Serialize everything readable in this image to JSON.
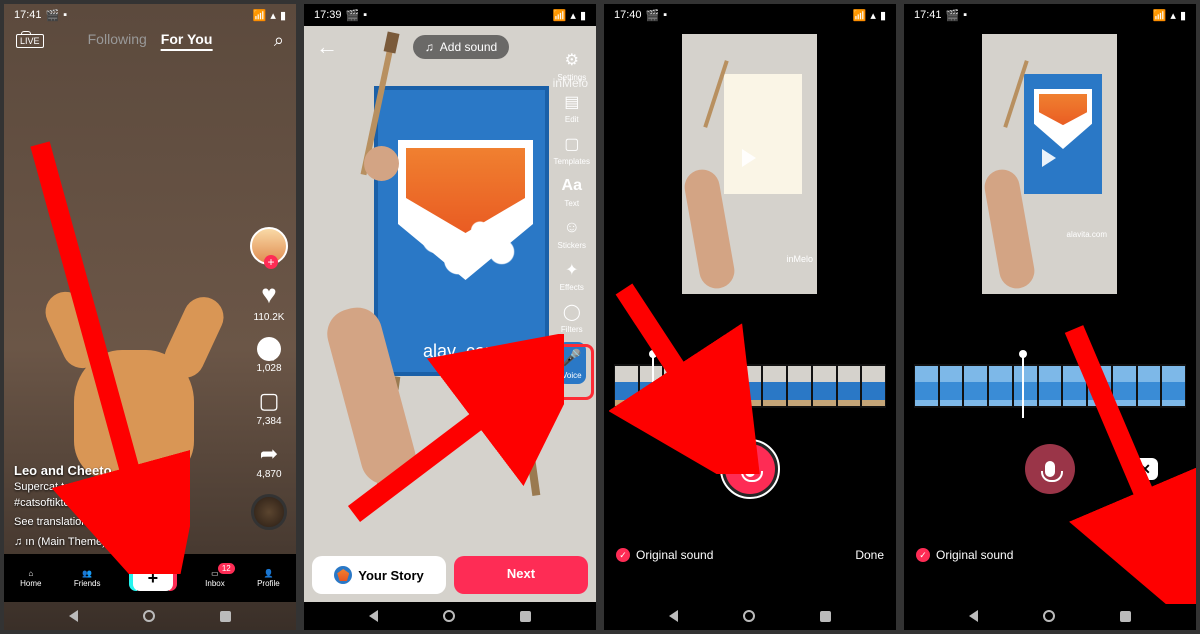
{
  "status": {
    "times": [
      "17:41",
      "17:39",
      "17:40",
      "17:41"
    ],
    "left_icons": [
      "🎬",
      "🔲"
    ],
    "right_icons": [
      "📶",
      "📡",
      "🔋"
    ]
  },
  "screen1": {
    "tabs": {
      "following": "Following",
      "foryou": "For You"
    },
    "user": "Leo and Cheeto",
    "caption_l1": "Supercat to your res...     ...yp",
    "caption_l2": "#catsoftiktok #...      ...ec...",
    "see_more": "See more",
    "see_translation": "See translation",
    "sound": "♫ ın (Main Theme) - 10ı...",
    "rail": {
      "likes": "110.2K",
      "comments": "1,028",
      "bookmarks": "7,384",
      "shares": "4,870"
    },
    "nav": {
      "home": "Home",
      "friends": "Friends",
      "inbox": "Inbox",
      "inbox_badge": "12",
      "profile": "Profile"
    }
  },
  "screen2": {
    "add_sound": "Add sound",
    "watermark": "inMelo",
    "canvas_text": "alav     .com",
    "rail": {
      "settings": "Settings",
      "edit": "Edit",
      "templates": "Templates",
      "text": "Aa",
      "stickers": "Stickers",
      "effects": "Effects",
      "filters": "Filters",
      "voice": "Voice"
    },
    "your_story": "Your Story",
    "next": "Next"
  },
  "screen34": {
    "canvas_text_full": "alavita.com",
    "watermark": "inMelo",
    "original_sound": "Original sound",
    "done": "Done",
    "delete_label": "✕"
  },
  "colors": {
    "accent": "#fe2c55",
    "blue": "#2a78c6"
  }
}
